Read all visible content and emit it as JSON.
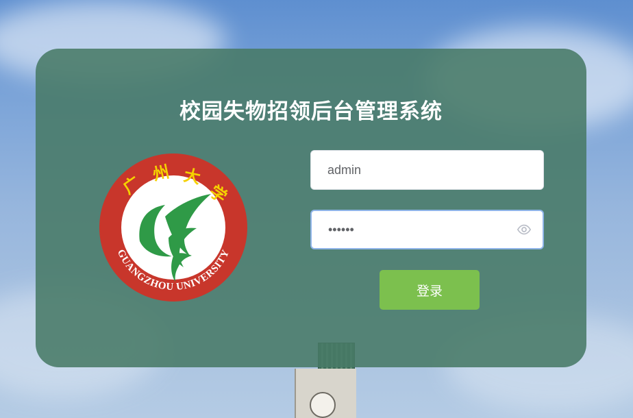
{
  "page": {
    "title": "校园失物招领后台管理系统"
  },
  "logo": {
    "chinese": [
      "广",
      "州",
      "大",
      "学"
    ],
    "english": "GUANGZHOU UNIVERSITY"
  },
  "login_form": {
    "username_value": "admin",
    "password_value": "••••••",
    "submit_label": "登录"
  },
  "icons": {
    "password_toggle": "eye-icon"
  },
  "colors": {
    "panel": "#4a7a66",
    "button": "#7cc04e",
    "logo_red": "#c8362b",
    "logo_yellow": "#f5d100",
    "logo_green": "#2f9a47"
  }
}
